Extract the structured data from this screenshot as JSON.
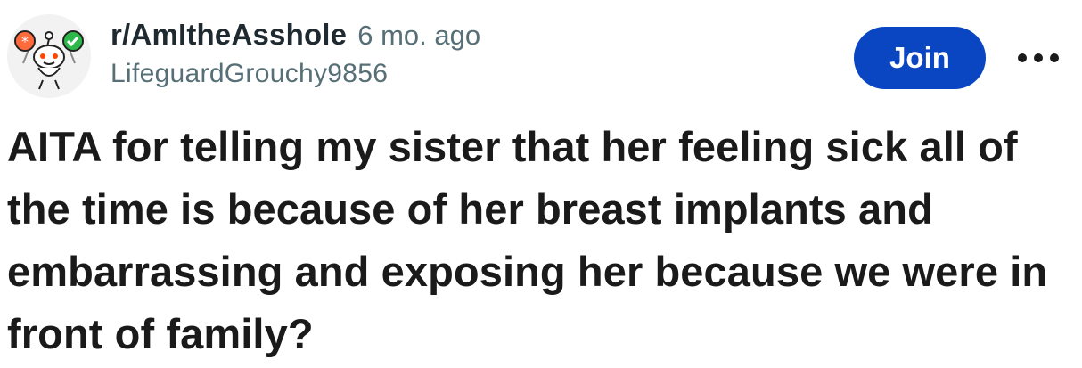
{
  "post": {
    "subreddit": "r/AmItheAsshole",
    "time_ago": "6 mo. ago",
    "username": "LifeguardGrouchy9856",
    "join_label": "Join",
    "title": "AITA for telling my sister that her feeling sick all of the time is because of her breast implants and embarrassing and exposing her because we were in front of family?"
  },
  "icons": {
    "avatar": "reddit-snoo-avatar-icon",
    "more": "more-options-icon"
  },
  "colors": {
    "join_button": "#0a45c2",
    "meta_text": "#576f76",
    "title_text": "#1a1a1b"
  }
}
